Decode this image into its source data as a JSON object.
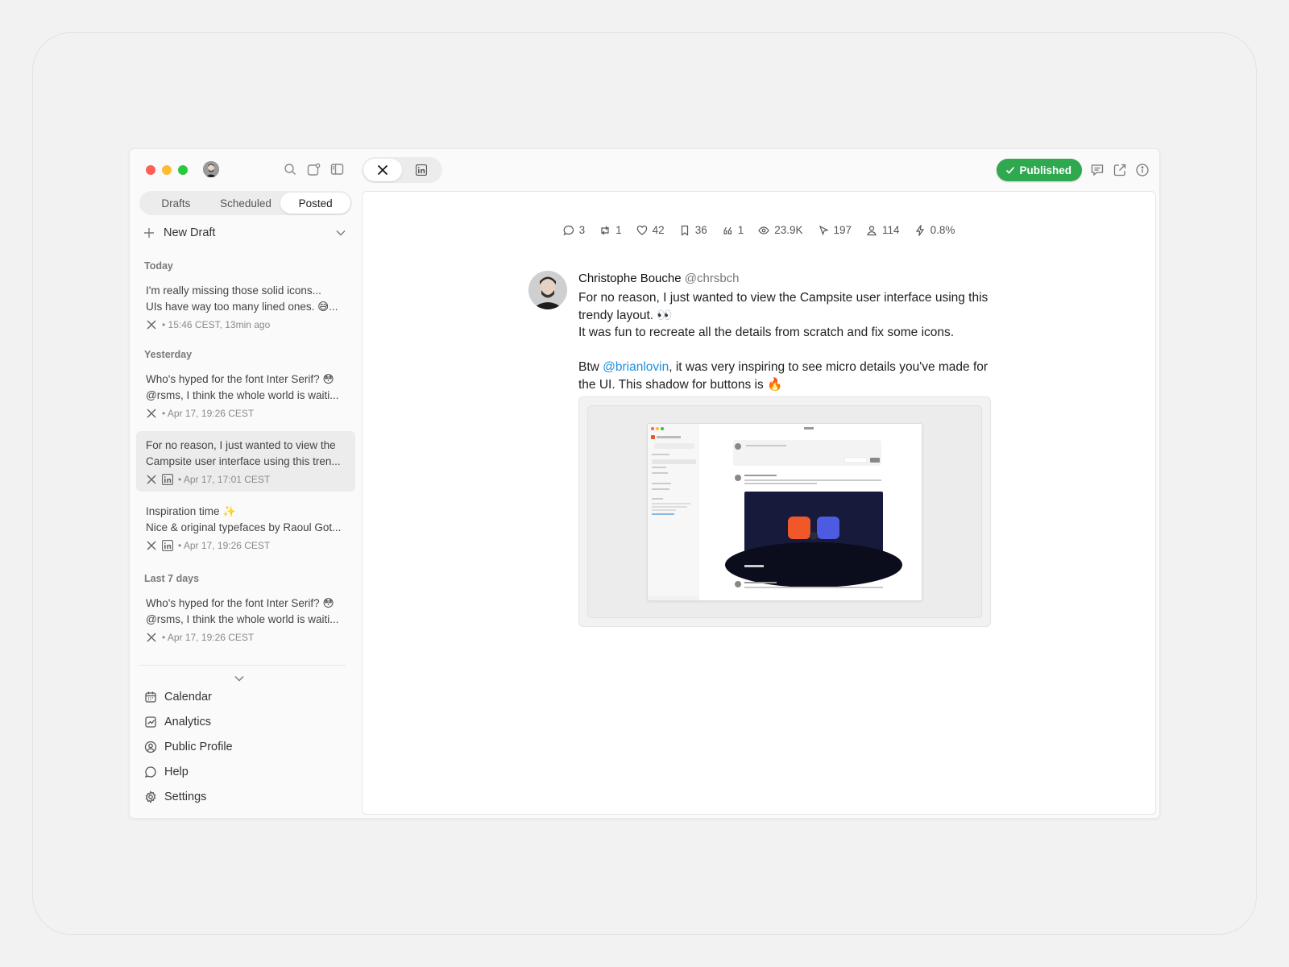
{
  "sidebar": {
    "tabs": [
      {
        "label": "Drafts"
      },
      {
        "label": "Scheduled"
      },
      {
        "label": "Posted"
      }
    ],
    "new_draft_label": "New Draft",
    "groups": [
      {
        "label": "Today"
      },
      {
        "label": "Yesterday"
      },
      {
        "label": "Last 7 days"
      }
    ],
    "posts": [
      {
        "line1": "I'm really missing those solid icons...",
        "line2": "UIs have way too many lined ones. 😅...",
        "meta": "• 15:46 CEST, 13min ago"
      },
      {
        "line1": "Who's hyped for the font Inter Serif? 😳",
        "line2": "@rsms, I think the whole world is waiti...",
        "meta": "• Apr 17, 19:26 CEST"
      },
      {
        "line1": "For no reason, I just wanted to view the",
        "line2": "Campsite user interface using this tren...",
        "meta": "• Apr 17, 17:01 CEST"
      },
      {
        "line1": "Inspiration time ✨",
        "line2": "Nice & original typefaces by Raoul Got...",
        "meta": "• Apr 17, 19:26 CEST"
      },
      {
        "line1": "Who's hyped for the font Inter Serif? 😳",
        "line2": "@rsms, I think the whole world is waiti...",
        "meta": "• Apr 17, 19:26 CEST"
      }
    ],
    "nav": [
      {
        "label": "Calendar",
        "icon": "calendar-icon"
      },
      {
        "label": "Analytics",
        "icon": "analytics-icon"
      },
      {
        "label": "Public Profile",
        "icon": "profile-icon"
      },
      {
        "label": "Help",
        "icon": "help-icon"
      },
      {
        "label": "Settings",
        "icon": "gear-icon"
      }
    ]
  },
  "header": {
    "status_label": "Published"
  },
  "stats": [
    {
      "icon": "reply-icon",
      "value": "3"
    },
    {
      "icon": "repost-icon",
      "value": "1"
    },
    {
      "icon": "like-icon",
      "value": "42"
    },
    {
      "icon": "bookmark-icon",
      "value": "36"
    },
    {
      "icon": "quote-icon",
      "value": "1"
    },
    {
      "icon": "views-icon",
      "value": "23.9K"
    },
    {
      "icon": "clicks-icon",
      "value": "197"
    },
    {
      "icon": "followers-icon",
      "value": "114"
    },
    {
      "icon": "engagement-icon",
      "value": "0.8%"
    }
  ],
  "tweet": {
    "author_name": "Christophe Bouche",
    "author_handle": "@chrsbch",
    "line1": "For no reason, I just wanted to view the Campsite user interface using this trendy layout. 👀",
    "line2": "It was fun to recreate all the details from scratch and fix some icons.",
    "btw": "Btw ",
    "mention": "@brianlovin",
    "line3_rest": ", it was very inspiring to see micro details you've made for the UI. This shadow for buttons is 🔥"
  },
  "colors": {
    "published": "#2fa84f",
    "mention": "#1d8fe0",
    "selected_item": "#ececec"
  }
}
